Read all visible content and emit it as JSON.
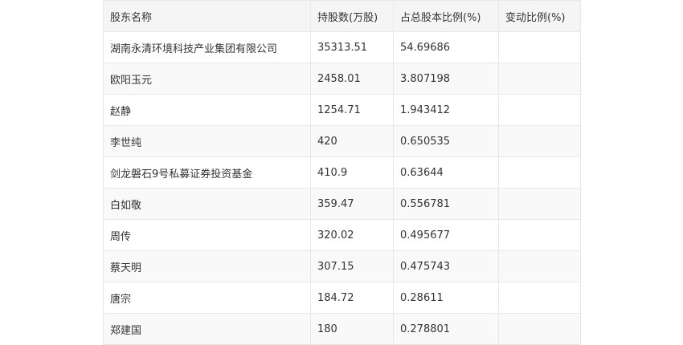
{
  "table": {
    "headers": [
      "股东名称",
      "持股数(万股)",
      "占总股本比例(%)",
      "变动比例(%)"
    ],
    "rows": [
      [
        "湖南永清环境科技产业集团有限公司",
        "35313.51",
        "54.69686",
        ""
      ],
      [
        "欧阳玉元",
        "2458.01",
        "3.807198",
        ""
      ],
      [
        "赵静",
        "1254.71",
        "1.943412",
        ""
      ],
      [
        "李世纯",
        "420",
        "0.650535",
        ""
      ],
      [
        "剑龙磐石9号私募证券投资基金",
        "410.9",
        "0.63644",
        ""
      ],
      [
        "白如敬",
        "359.47",
        "0.556781",
        ""
      ],
      [
        "周传",
        "320.02",
        "0.495677",
        ""
      ],
      [
        "蔡天明",
        "307.15",
        "0.475743",
        ""
      ],
      [
        "唐宗",
        "184.72",
        "0.28611",
        ""
      ],
      [
        "郑建国",
        "180",
        "0.278801",
        ""
      ]
    ]
  }
}
